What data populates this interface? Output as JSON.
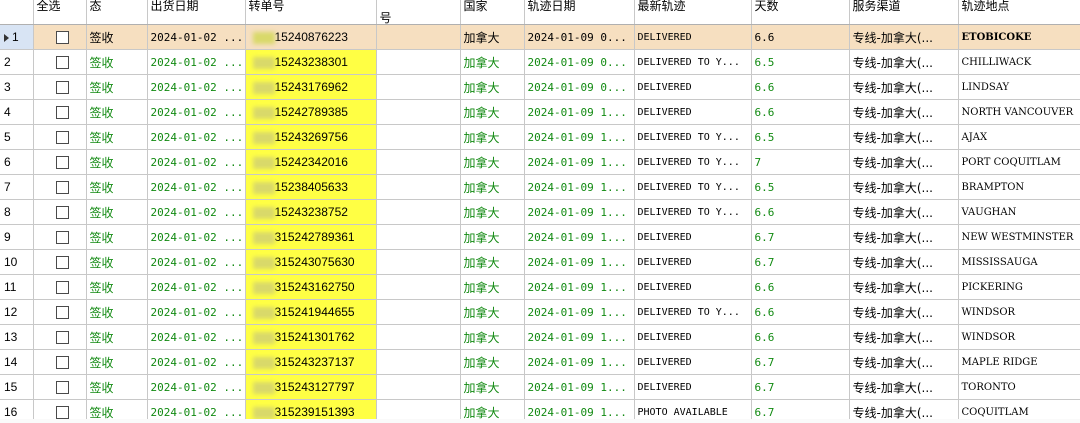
{
  "headers": {
    "c0": "",
    "c1": "全选",
    "c2_a": "",
    "c2_b": "态",
    "c3": "出货日期",
    "c4": "转单号",
    "c5": "号",
    "c6": "国家",
    "c7": "轨迹日期",
    "c8": "最新轨迹",
    "c9_a": "",
    "c9_b": "天数",
    "c10": "服务渠道",
    "c11": "轨迹地点"
  },
  "rows": [
    {
      "n": "1",
      "status": "签收",
      "ship": "2024-01-02 ...",
      "trk": "15240876223",
      "cty": "加拿大",
      "tdate": "2024-01-09 0...",
      "event": "DELIVERED",
      "days": "6.6",
      "chan": "专线-加拿大(...",
      "loc": "ETOBICOKE"
    },
    {
      "n": "2",
      "status": "签收",
      "ship": "2024-01-02 ...",
      "trk": "15243238301",
      "cty": "加拿大",
      "tdate": "2024-01-09 0...",
      "event": "DELIVERED TO Y...",
      "days": "6.5",
      "chan": "专线-加拿大(...",
      "loc": "CHILLIWACK"
    },
    {
      "n": "3",
      "status": "签收",
      "ship": "2024-01-02 ...",
      "trk": "15243176962",
      "cty": "加拿大",
      "tdate": "2024-01-09 0...",
      "event": "DELIVERED",
      "days": "6.6",
      "chan": "专线-加拿大(...",
      "loc": "LINDSAY"
    },
    {
      "n": "4",
      "status": "签收",
      "ship": "2024-01-02 ...",
      "trk": "15242789385",
      "cty": "加拿大",
      "tdate": "2024-01-09 1...",
      "event": "DELIVERED",
      "days": "6.6",
      "chan": "专线-加拿大(...",
      "loc": "NORTH VANCOUVER"
    },
    {
      "n": "5",
      "status": "签收",
      "ship": "2024-01-02 ...",
      "trk": "15243269756",
      "cty": "加拿大",
      "tdate": "2024-01-09 1...",
      "event": "DELIVERED TO Y...",
      "days": "6.5",
      "chan": "专线-加拿大(...",
      "loc": "AJAX"
    },
    {
      "n": "6",
      "status": "签收",
      "ship": "2024-01-02 ...",
      "trk": "15242342016",
      "cty": "加拿大",
      "tdate": "2024-01-09 1...",
      "event": "DELIVERED TO Y...",
      "days": "7",
      "chan": "专线-加拿大(...",
      "loc": "PORT COQUITLAM"
    },
    {
      "n": "7",
      "status": "签收",
      "ship": "2024-01-02 ...",
      "trk": "15238405633",
      "cty": "加拿大",
      "tdate": "2024-01-09 1...",
      "event": "DELIVERED TO Y...",
      "days": "6.5",
      "chan": "专线-加拿大(...",
      "loc": "BRAMPTON"
    },
    {
      "n": "8",
      "status": "签收",
      "ship": "2024-01-02 ...",
      "trk": "15243238752",
      "cty": "加拿大",
      "tdate": "2024-01-09 1...",
      "event": "DELIVERED TO Y...",
      "days": "6.6",
      "chan": "专线-加拿大(...",
      "loc": "VAUGHAN"
    },
    {
      "n": "9",
      "status": "签收",
      "ship": "2024-01-02 ...",
      "trk": "315242789361",
      "cty": "加拿大",
      "tdate": "2024-01-09 1...",
      "event": "DELIVERED",
      "days": "6.7",
      "chan": "专线-加拿大(...",
      "loc": "NEW WESTMINSTER"
    },
    {
      "n": "10",
      "status": "签收",
      "ship": "2024-01-02 ...",
      "trk": "315243075630",
      "cty": "加拿大",
      "tdate": "2024-01-09 1...",
      "event": "DELIVERED",
      "days": "6.7",
      "chan": "专线-加拿大(...",
      "loc": "MISSISSAUGA"
    },
    {
      "n": "11",
      "status": "签收",
      "ship": "2024-01-02 ...",
      "trk": "315243162750",
      "cty": "加拿大",
      "tdate": "2024-01-09 1...",
      "event": "DELIVERED",
      "days": "6.6",
      "chan": "专线-加拿大(...",
      "loc": "PICKERING"
    },
    {
      "n": "12",
      "status": "签收",
      "ship": "2024-01-02 ...",
      "trk": "315241944655",
      "cty": "加拿大",
      "tdate": "2024-01-09 1...",
      "event": "DELIVERED TO Y...",
      "days": "6.6",
      "chan": "专线-加拿大(...",
      "loc": "WINDSOR"
    },
    {
      "n": "13",
      "status": "签收",
      "ship": "2024-01-02 ...",
      "trk": "315241301762",
      "cty": "加拿大",
      "tdate": "2024-01-09 1...",
      "event": "DELIVERED",
      "days": "6.6",
      "chan": "专线-加拿大(...",
      "loc": "WINDSOR"
    },
    {
      "n": "14",
      "status": "签收",
      "ship": "2024-01-02 ...",
      "trk": "315243237137",
      "cty": "加拿大",
      "tdate": "2024-01-09 1...",
      "event": "DELIVERED",
      "days": "6.7",
      "chan": "专线-加拿大(...",
      "loc": "MAPLE RIDGE"
    },
    {
      "n": "15",
      "status": "签收",
      "ship": "2024-01-02 ...",
      "trk": "315243127797",
      "cty": "加拿大",
      "tdate": "2024-01-09 1...",
      "event": "DELIVERED",
      "days": "6.7",
      "chan": "专线-加拿大(...",
      "loc": "TORONTO"
    },
    {
      "n": "16",
      "status": "签收",
      "ship": "2024-01-02 ...",
      "trk": "315239151393",
      "cty": "加拿大",
      "tdate": "2024-01-09 1...",
      "event": "PHOTO AVAILABLE",
      "days": "6.7",
      "chan": "专线-加拿大(...",
      "loc": "COQUITLAM"
    }
  ],
  "selected_row": "1",
  "colors": {
    "status_green": "#118a11",
    "tracking_highlight": "#ffff44",
    "selected_row": "#f6dfc0",
    "grid_line": "#c8c8c8"
  },
  "icons": {
    "checkbox": "checkbox-icon",
    "current_row": "row-pointer-icon"
  }
}
